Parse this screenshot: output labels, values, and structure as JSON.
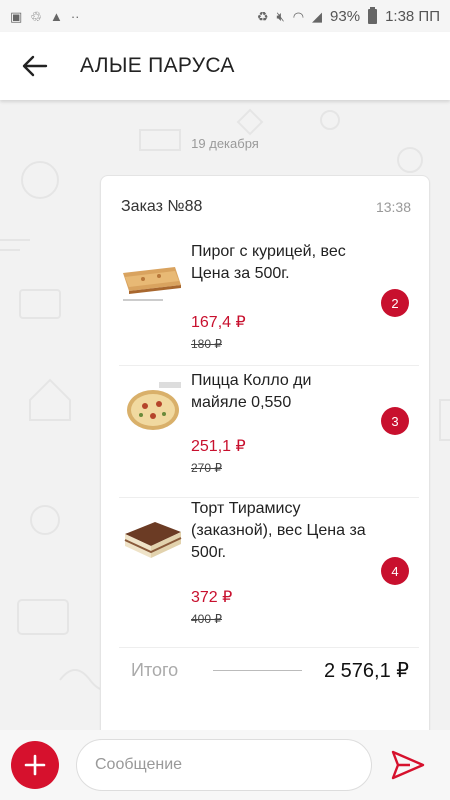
{
  "status_bar": {
    "battery": "93%",
    "time": "1:38 ПП"
  },
  "header": {
    "title": "АЛЫЕ ПАРУСА"
  },
  "chat": {
    "date": "19 декабря",
    "order": {
      "title": "Заказ №88",
      "time": "13:38",
      "items": [
        {
          "name": "Пирог с курицей, вес Цена за 500г.",
          "price": "167,4 ₽",
          "old_price": "180 ₽",
          "qty": "2"
        },
        {
          "name": "Пицца Колло ди майяле 0,550",
          "price": "251,1 ₽",
          "old_price": "270 ₽",
          "qty": "3"
        },
        {
          "name": "Торт Тирамису (заказной), вес Цена за 500г.",
          "price": "372 ₽",
          "old_price": "400 ₽",
          "qty": "4"
        }
      ],
      "total_label": "Итого",
      "total_value": "2 576,1 ₽"
    }
  },
  "composer": {
    "placeholder": "Сообщение"
  },
  "colors": {
    "accent": "#c8102e",
    "button": "#d6112d",
    "background": "#f2f2f2"
  },
  "icons": {
    "back": "arrow-left-icon",
    "add": "plus-icon",
    "send": "send-icon"
  }
}
